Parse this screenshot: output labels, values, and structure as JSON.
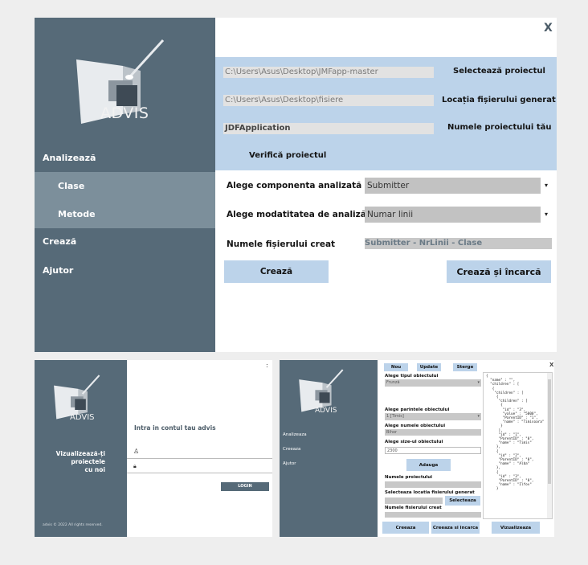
{
  "main": {
    "logo_text": "ADVIS",
    "close_symbol": "X",
    "sidebar": [
      {
        "label": "Analizează"
      },
      {
        "label": "Clase"
      },
      {
        "label": "Metode"
      },
      {
        "label": "Crează"
      },
      {
        "label": "Ajutor"
      }
    ],
    "paths": {
      "project_path": "C:\\Users\\Asus\\Desktop\\JMFapp-master",
      "project_label": "Selectează proiectul",
      "output_path": "C:\\Users\\Asus\\Desktop\\fisiere",
      "output_label": "Locația fișierului generat",
      "project_name": "JDFApplication",
      "project_name_label": "Numele proiectului tău",
      "verify_label": "Verifică proiectul"
    },
    "form": {
      "component_label": "Alege componenta analizată",
      "component_value": "Submitter",
      "mode_label": "Alege modatitatea de analiză",
      "mode_value": "Numar linii",
      "filename_label": "Numele fișierului creat",
      "filename_value": "Submitter - NrLinii - Clase",
      "create_button": "Crează",
      "create_upload_button": "Crează și încarcă"
    }
  },
  "login": {
    "logo_text": "ADVIS",
    "tagline": [
      "Vizualizează-ți",
      "proiectele",
      "cu noi"
    ],
    "footer": "advis © 2022 All rights reserved.",
    "title": "Intra in contul tau advis",
    "login_button": "LOGIN",
    "close_symbol": ":"
  },
  "editor": {
    "logo_text": "ADVIS",
    "sidebar": [
      "Analizeaza",
      "Creeaza",
      "Ajutor"
    ],
    "top_buttons": [
      "Nou",
      "Update",
      "Sterge"
    ],
    "type_label": "Alege tipul obiectului",
    "type_value": "Frunză",
    "parent_label": "Alege parintele obiectului",
    "parent_value": "1 [Timis]",
    "name_label": "Alege numele obiectului",
    "name_value": "Bihor",
    "size_label": "Alege size-ul obiectului",
    "size_value": "2300",
    "add_button": "Adauga",
    "project_name_label": "Numele proiectului",
    "location_label": "Selecteaza locatia fisierului generat",
    "select_button": "Selecteaza",
    "file_name_label": "Numele fisierului creat",
    "bottom_buttons": [
      "Creeaza",
      "Creeaza si incarca",
      "Vizualizeaza"
    ],
    "json_text": "{\n  \"name\" : \"\",\n  \"children\" : [\n   {\n    \"children\" : [\n     {\n      \"children\" : [\n       {\n        \"id\" : \"3\",\n        \"value\" : \"5000\",\n        \"ParentID\" : \"1\",\n        \"name\" : \"Timisoara\"\n       }\n      ],\n      \"id\" : \"1\",\n      \"ParentID\" : \"0\",\n      \"name\" : \"Timis\"\n     },\n     {\n      \"id\" : \"2\",\n      \"ParentID\" : \"0\",\n      \"name\" : \"Alba\"\n     },\n     {\n      \"id\" : \"3\",\n      \"ParentID\" : \"0\",\n      \"name\" : \"Ilfov\"\n     }",
    "close_symbol": "X"
  }
}
